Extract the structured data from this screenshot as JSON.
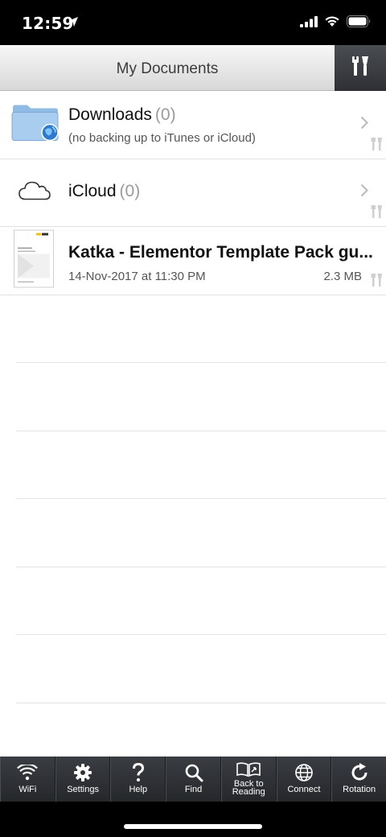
{
  "status": {
    "time": "12:59"
  },
  "navbar": {
    "title": "My Documents"
  },
  "rows": [
    {
      "title": "Downloads",
      "count": "(0)",
      "subtitle": "(no backing up to iTunes or iCloud)"
    },
    {
      "title": "iCloud",
      "count": "(0)"
    },
    {
      "title": "Katka - Elementor Template Pack gu...",
      "date": "14-Nov-2017 at 11:30 PM",
      "size": "2.3 MB"
    }
  ],
  "toolbar": {
    "items": [
      {
        "label": "WiFi",
        "icon": "wifi-icon"
      },
      {
        "label": "Settings",
        "icon": "gear-icon"
      },
      {
        "label": "Help",
        "icon": "question-icon"
      },
      {
        "label": "Find",
        "icon": "search-icon"
      },
      {
        "label": "Back to Reading",
        "icon": "book-icon"
      },
      {
        "label": "Connect",
        "icon": "globe-icon"
      },
      {
        "label": "Rotation",
        "icon": "rotate-icon"
      }
    ]
  },
  "colors": {
    "toolbar_bg": "#2e3034",
    "accent_folder": "#7fb4e6"
  }
}
